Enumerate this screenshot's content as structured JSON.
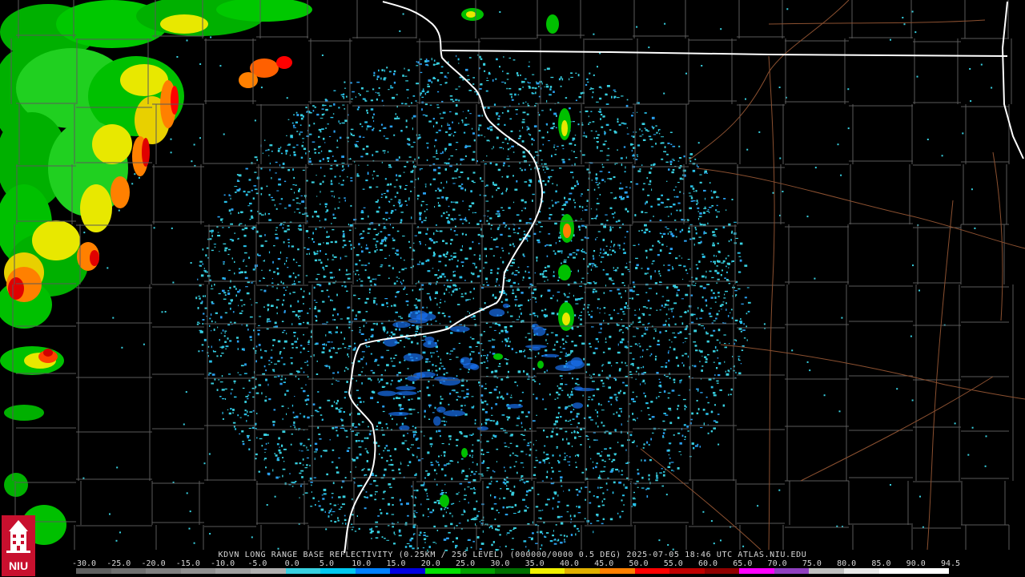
{
  "product_line": "KDVN LONG RANGE BASE REFLECTIVITY (0.25KM / 256 LEVEL) (000000/0000 0.5 DEG) 2025-07-05 18:46 UTC  ATLAS.NIU.EDU",
  "scale_labels": [
    "-30.0",
    "-25.0",
    "-20.0",
    "-15.0",
    "-10.0",
    "-5.0",
    "0.0",
    "5.0",
    "10.0",
    "15.0",
    "20.0",
    "25.0",
    "30.0",
    "35.0",
    "40.0",
    "45.0",
    "50.0",
    "55.0",
    "60.0",
    "65.0",
    "70.0",
    "75.0",
    "80.0",
    "85.0",
    "90.0",
    "94.5"
  ],
  "scale_colors": [
    "#606060",
    "#707070",
    "#808080",
    "#909090",
    "#a0a0a0",
    "#b0b0b0",
    "#38d0e0",
    "#00c8f0",
    "#0080ff",
    "#0000e0",
    "#00e000",
    "#00a000",
    "#007000",
    "#f0f000",
    "#e0b000",
    "#ff8000",
    "#ff0000",
    "#c00000",
    "#900000",
    "#ff00ff",
    "#9040c0",
    "#c0c0c0",
    "#e8e8e8",
    "#ffffff",
    "#ffffff"
  ],
  "logo_text": "NIU",
  "colors": {
    "county_lines": "#5a5a5a",
    "state_lines": "#ffffff",
    "highways": "#8b5030",
    "background": "#000000"
  }
}
